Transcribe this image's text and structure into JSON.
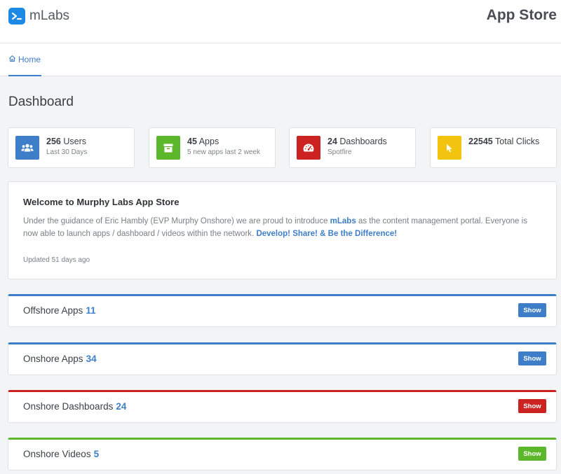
{
  "brand": {
    "name": "mLabs"
  },
  "header": {
    "title": "App Store"
  },
  "nav": {
    "home_label": "Home"
  },
  "page": {
    "title": "Dashboard"
  },
  "stats": [
    {
      "value": "256",
      "label": "Users",
      "sub": "Last 30 Days",
      "icon": "users-icon",
      "color": "#3e7ec9"
    },
    {
      "value": "45",
      "label": "Apps",
      "sub": "5 new apps last 2 week",
      "icon": "box-icon",
      "color": "#5cb82a"
    },
    {
      "value": "24",
      "label": "Dashboards",
      "sub": "Spotfire",
      "icon": "gauge-icon",
      "color": "#cc2222"
    },
    {
      "value": "22545",
      "label": "Total Clicks",
      "sub": "",
      "icon": "pointer-icon",
      "color": "#f2c40f"
    }
  ],
  "welcome": {
    "title": "Welcome to Murphy Labs App Store",
    "body_1": "Under the guidance of Eric Hambly (EVP Murphy Onshore) we are proud to introduce",
    "body_brand": "mLabs",
    "body_2": "as the content management portal. Everyone is now able to launch apps / dashboard / videos within the network.",
    "body_cta": "Develop! Share! & Be the Difference!",
    "updated": "Updated 51 days ago"
  },
  "sections": [
    {
      "label": "Offshore Apps",
      "count": "11",
      "button": "Show",
      "color": "#3e7ec9"
    },
    {
      "label": "Onshore Apps",
      "count": "34",
      "button": "Show",
      "color": "#3e7ec9"
    },
    {
      "label": "Onshore Dashboards",
      "count": "24",
      "button": "Show",
      "color": "#cc2222"
    },
    {
      "label": "Onshore Videos",
      "count": "5",
      "button": "Show",
      "color": "#5cb82a"
    }
  ]
}
